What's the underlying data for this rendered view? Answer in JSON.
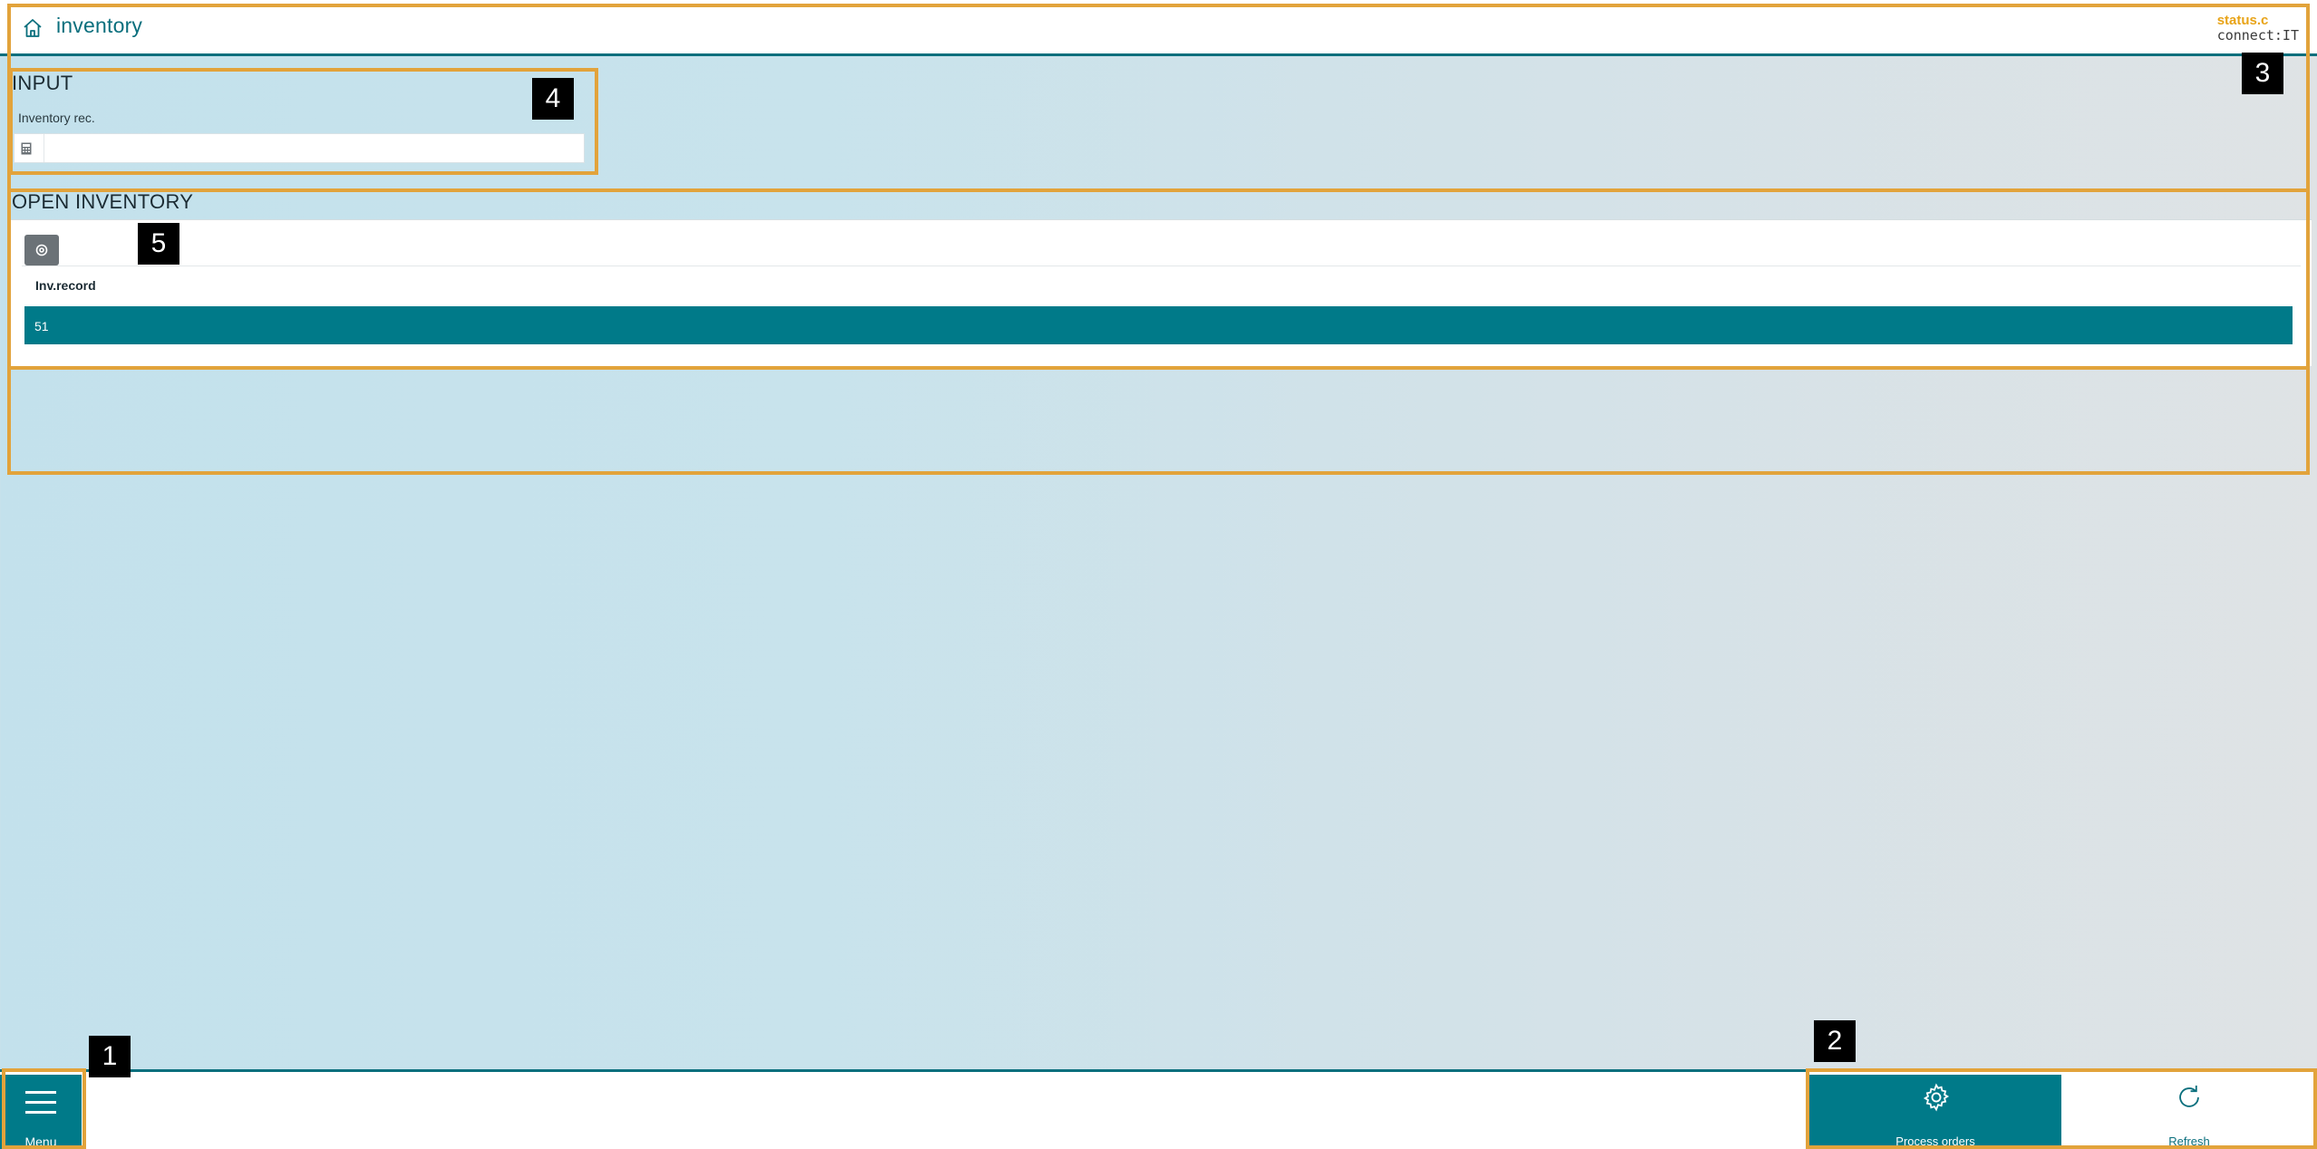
{
  "header": {
    "home_icon": "home-icon",
    "title": "inventory",
    "brand_top": "status.c",
    "brand_bottom": "connect:IT"
  },
  "input_section": {
    "title": "INPUT",
    "field_label": "Inventory rec.",
    "field_icon": "calculator-icon",
    "field_value": "",
    "field_placeholder": ""
  },
  "open_inventory": {
    "title": "OPEN INVENTORY",
    "settings_icon": "settings-icon",
    "columns": [
      "Inv.record"
    ],
    "rows": [
      {
        "inv_record": "51",
        "selected": true
      }
    ]
  },
  "bottom_bar": {
    "menu_label": "Menu",
    "menu_icon": "hamburger-icon",
    "process_orders_label": "Process orders",
    "process_orders_icon": "gear-icon",
    "refresh_label": "Refresh",
    "refresh_icon": "refresh-icon"
  },
  "annotations": [
    "1",
    "2",
    "3",
    "4",
    "5"
  ],
  "colors": {
    "accent": "#007a89",
    "header_accent": "#0a6f7d",
    "annotation_border": "#e2a33b",
    "brand_orange": "#e8a317"
  }
}
